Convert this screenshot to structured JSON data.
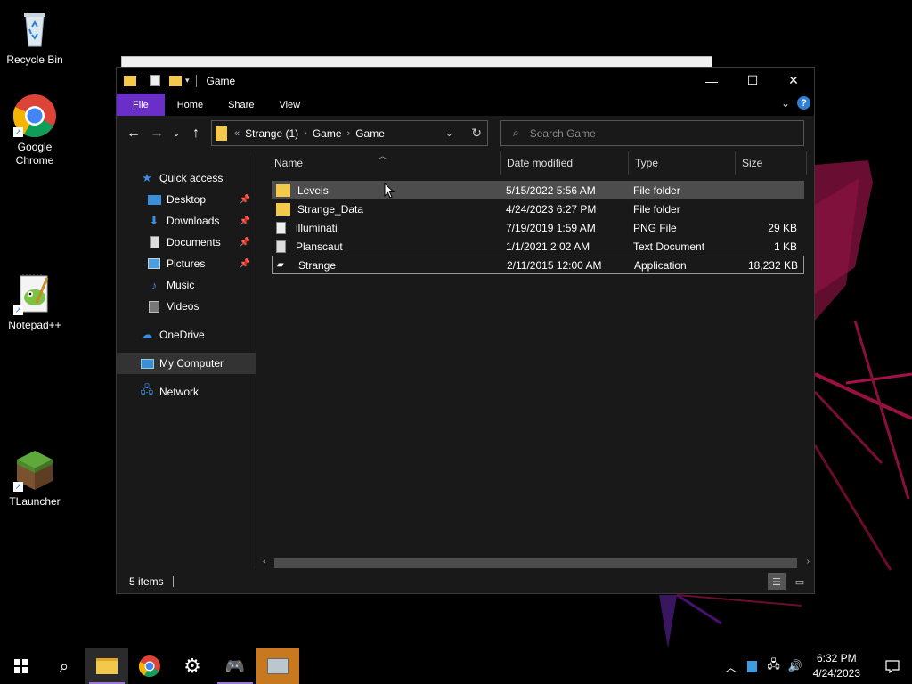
{
  "desktop": {
    "icons": [
      {
        "label": "Recycle Bin",
        "icon": "recycle-bin-icon"
      },
      {
        "label": "Google Chrome",
        "icon": "chrome-icon"
      },
      {
        "label": "Notepad++",
        "icon": "notepad-plus-plus-icon"
      },
      {
        "label": "TLauncher",
        "icon": "tlauncher-icon"
      }
    ]
  },
  "window": {
    "title": "Game",
    "controls": {
      "minimize": "—",
      "maximize": "☐",
      "close": "✕"
    },
    "ribbon": {
      "tabs": [
        "File",
        "Home",
        "Share",
        "View"
      ],
      "help": "?"
    },
    "address": {
      "overflow": "«",
      "crumbs": [
        "Strange (1)",
        "Game",
        "Game"
      ]
    },
    "search": {
      "placeholder": "Search Game"
    },
    "nav_pane": [
      {
        "label": "Quick access",
        "icon": "star-icon",
        "pinned": false
      },
      {
        "label": "Desktop",
        "icon": "desktop-icon",
        "pinned": true
      },
      {
        "label": "Downloads",
        "icon": "download-icon",
        "pinned": true
      },
      {
        "label": "Documents",
        "icon": "documents-icon",
        "pinned": true
      },
      {
        "label": "Pictures",
        "icon": "pictures-icon",
        "pinned": true
      },
      {
        "label": "Music",
        "icon": "music-icon",
        "pinned": false
      },
      {
        "label": "Videos",
        "icon": "videos-icon",
        "pinned": false
      },
      {
        "label": "OneDrive",
        "icon": "onedrive-icon",
        "pinned": false
      },
      {
        "label": "My Computer",
        "icon": "computer-icon",
        "pinned": false
      },
      {
        "label": "Network",
        "icon": "network-icon",
        "pinned": false
      }
    ],
    "columns": [
      "Name",
      "Date modified",
      "Type",
      "Size"
    ],
    "files": [
      {
        "name": "Levels",
        "date": "5/15/2022 5:56 AM",
        "type": "File folder",
        "size": "",
        "icon": "folder-icon"
      },
      {
        "name": "Strange_Data",
        "date": "4/24/2023 6:27 PM",
        "type": "File folder",
        "size": "",
        "icon": "folder-icon"
      },
      {
        "name": "illuminati",
        "date": "7/19/2019 1:59 AM",
        "type": "PNG File",
        "size": "29 KB",
        "icon": "png-file-icon"
      },
      {
        "name": "Planscaut",
        "date": "1/1/2021 2:02 AM",
        "type": "Text Document",
        "size": "1 KB",
        "icon": "text-file-icon"
      },
      {
        "name": "Strange",
        "date": "2/11/2015 12:00 AM",
        "type": "Application",
        "size": "18,232 KB",
        "icon": "application-icon"
      }
    ],
    "status": {
      "items_count": "5 items"
    }
  },
  "taskbar": {
    "clock_time": "6:32 PM",
    "clock_date": "4/24/2023"
  },
  "colors": {
    "accent": "#6a2fc9",
    "folder": "#f3c94d"
  }
}
